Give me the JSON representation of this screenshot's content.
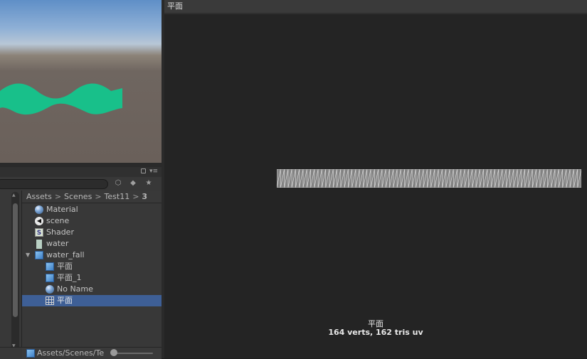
{
  "project": {
    "breadcrumb": [
      "Assets",
      "Scenes",
      "Test11",
      "3"
    ],
    "assets": [
      {
        "label": "Material",
        "icon": "material-sphere-icon"
      },
      {
        "label": "scene",
        "icon": "unity-scene-icon"
      },
      {
        "label": "Shader",
        "icon": "shader-icon",
        "glyph": "S"
      },
      {
        "label": "water",
        "icon": "texture-icon"
      },
      {
        "label": "water_fall",
        "icon": "model-prefab-icon",
        "expanded": true
      },
      {
        "label": "平面",
        "icon": "model-prefab-icon"
      },
      {
        "label": "平面_1",
        "icon": "model-prefab-icon"
      },
      {
        "label": "No Name",
        "icon": "material-sphere-icon"
      },
      {
        "label": "平面",
        "icon": "mesh-grid-icon",
        "selected": true
      }
    ],
    "path_bar": "Assets/Scenes/Te"
  },
  "preview": {
    "title": "平面",
    "mesh_name": "平面",
    "stats": "164 verts, 162 tris   uv"
  },
  "colors": {
    "wave": "#18c08a",
    "selection": "#3e5f96",
    "mesh": "#d8d8d8"
  }
}
